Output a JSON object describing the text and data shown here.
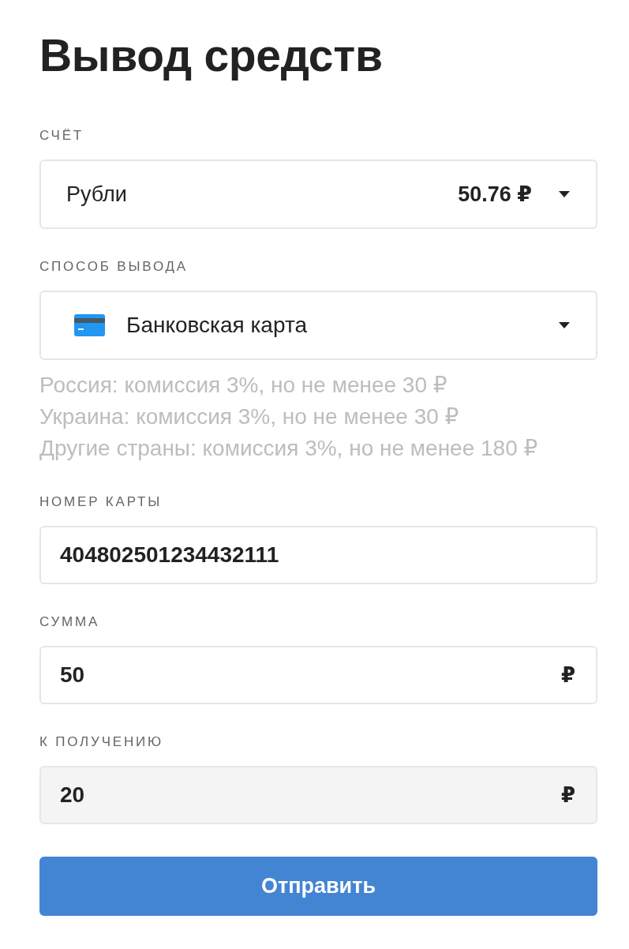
{
  "title": "Вывод средств",
  "fields": [
    {
      "kind": "balance-select",
      "label": "СЧЁТ",
      "value": "Рубли",
      "amount": "50.76 ₽"
    },
    {
      "kind": "method-select",
      "label": "СПОСОБ ВЫВОДА",
      "value": "Банковская карта",
      "notes": [
        "Россия: комиссия 3%, но не менее 30 ₽",
        "Украина: комиссия 3%, но не менее 30 ₽",
        "Другие страны: комиссия 3%, но не менее 180 ₽"
      ]
    },
    {
      "kind": "text-input",
      "label": "НОМЕР КАРТЫ",
      "value": "404802501234432111"
    },
    {
      "kind": "amount-input",
      "label": "СУММА",
      "value": "50",
      "suffix": "₽"
    },
    {
      "kind": "readonly-amount-input",
      "label": "К ПОЛУЧЕНИЮ",
      "value": "20",
      "suffix": "₽"
    }
  ],
  "submit": {
    "label": "Отправить"
  }
}
